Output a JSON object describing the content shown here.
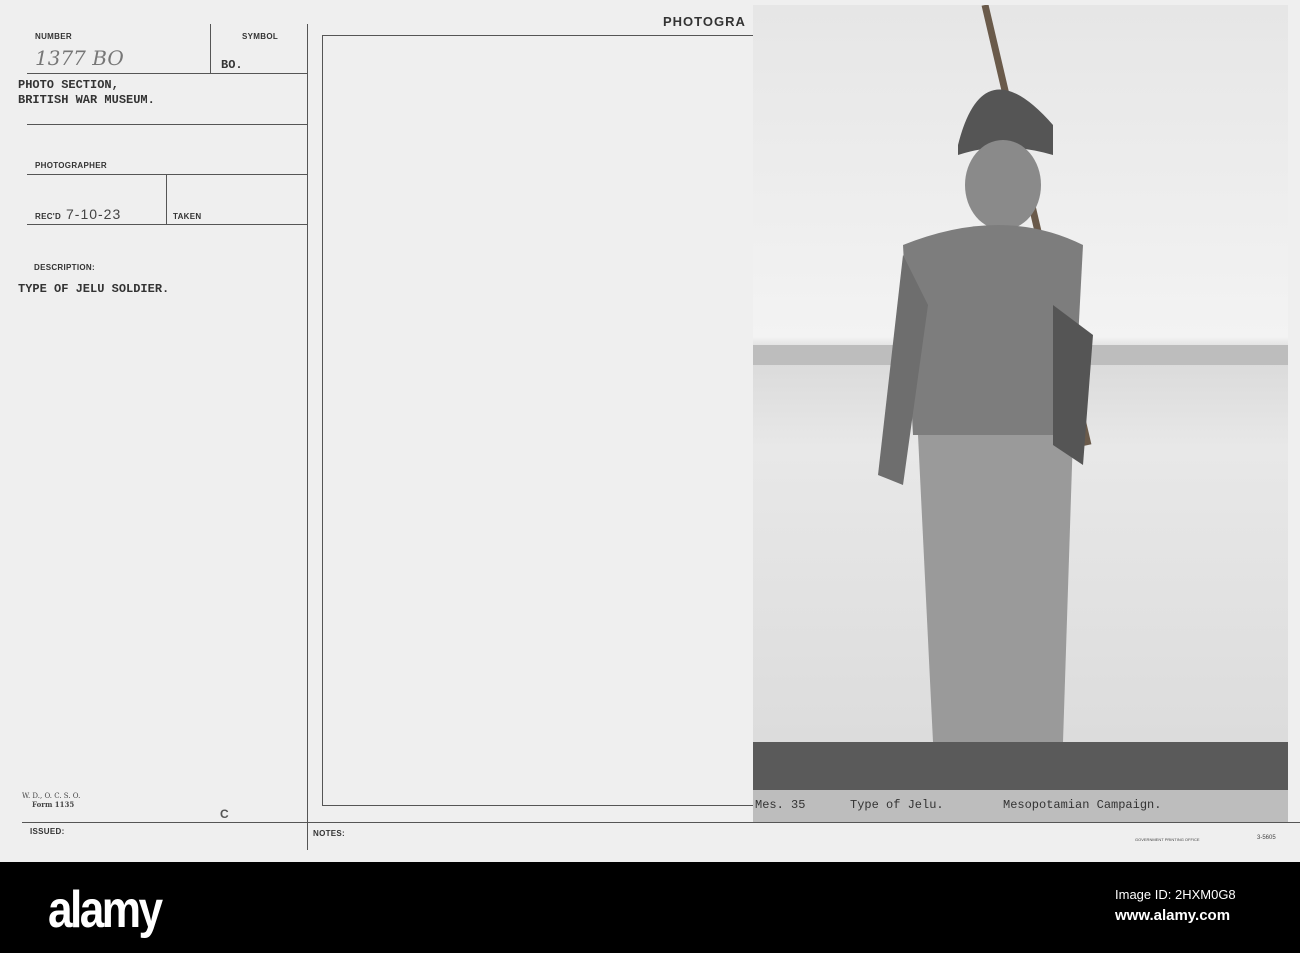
{
  "card": {
    "number_label": "NUMBER",
    "number_value": "1377 BO",
    "symbol_label": "SYMBOL",
    "symbol_value": "BO.",
    "section_line1": "PHOTO SECTION,",
    "section_line2": "BRITISH WAR MUSEUM.",
    "photographer_label": "PHOTOGRAPHER",
    "recd_label": "REC'D",
    "recd_value": "7-10-23",
    "taken_label": "TAKEN",
    "description_label": "DESCRIPTION:",
    "description_value": "TYPE OF JELU SOLDIER.",
    "form_line1": "W. D., O. C. S. O.",
    "form_line2": "Form 1135",
    "issued_label": "ISSUED:",
    "letter_mark": "C",
    "notes_label": "NOTES:",
    "photograph_label": "PHOTOGRA"
  },
  "photo": {
    "caption_number": "Mes. 35",
    "caption_title": "Type of Jelu.",
    "caption_campaign": "Mesopotamian Campaign.",
    "printer_imprint": "GOVERNMENT PRINTING OFFICE",
    "printer_code": "3-5605"
  },
  "watermark": {
    "logo": "alamy",
    "image_id": "Image ID: 2HXM0G8",
    "url": "www.alamy.com"
  }
}
